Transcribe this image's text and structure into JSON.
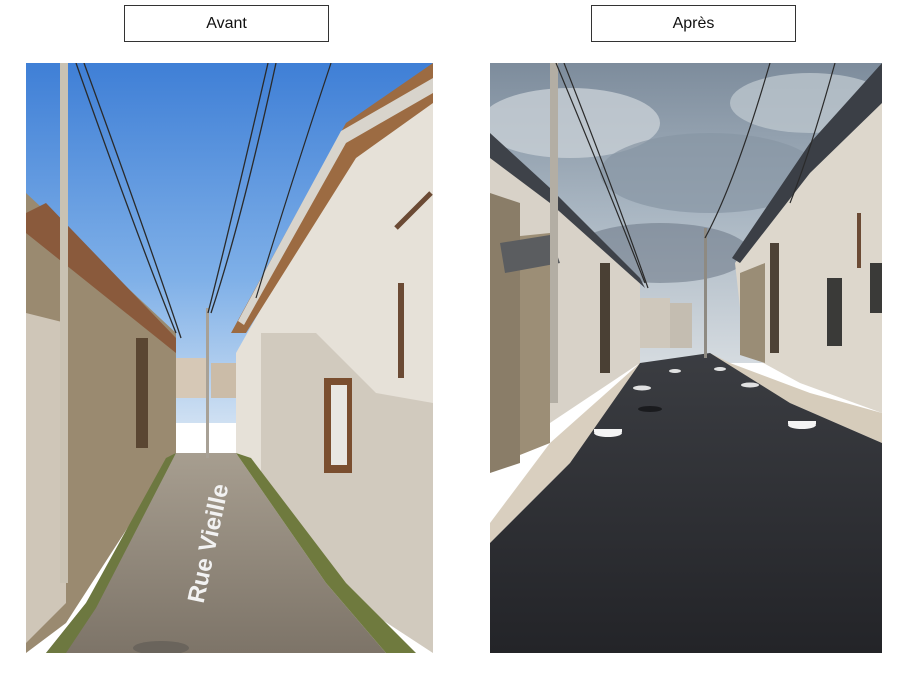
{
  "labels": {
    "before": "Avant",
    "after": "Après"
  },
  "photo_before": {
    "painted_street_name": "Rue Vieille"
  },
  "colors": {
    "sky_clear": "#4a86d8",
    "sky_cloudy": "#9aa9b8",
    "asphalt_new": "#2b2d31",
    "road_old": "#8f8678",
    "wall_render": "#e3ddd3",
    "stone_wall": "#9a8a70",
    "roof_tile": "#8a5a3c",
    "gravel": "#d9cfbf"
  }
}
